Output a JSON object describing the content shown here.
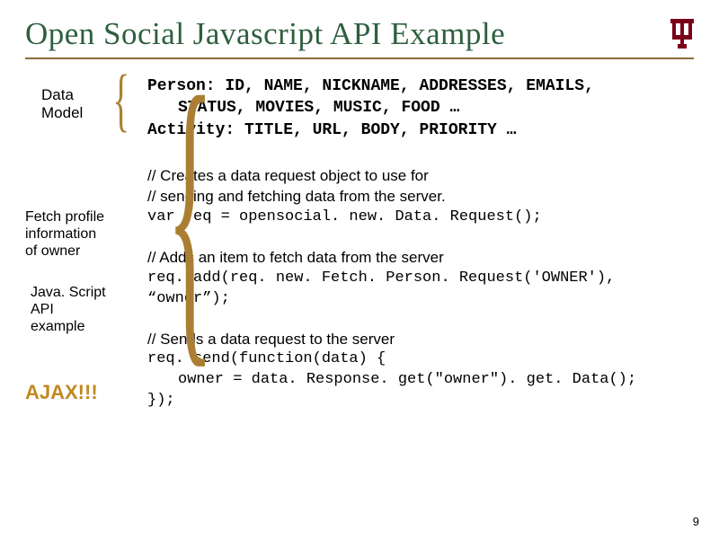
{
  "title": "Open Social Javascript API Example",
  "page_number": "9",
  "left": {
    "data_model_label": "Data\nModel",
    "fetch_label": "Fetch profile\ninformation\nof owner",
    "js_label": "Java. Script\nAPI\nexample",
    "ajax_label": "AJAX!!!"
  },
  "data_model": {
    "line1": "Person: ID, NAME, NICKNAME, ADDRESSES, EMAILS,",
    "line2": "STATUS, MOVIES, MUSIC, FOOD …",
    "line3": "Activity: TITLE, URL, BODY, PRIORITY …"
  },
  "block1": {
    "c1": "// Creates a data request object to use for",
    "c2": "// sending and fetching data from the server.",
    "code": "var req = opensocial. new. Data. Request();"
  },
  "block2": {
    "c1": "// Adds an item to fetch data from the server",
    "code": "req. add(req. new. Fetch. Person. Request('OWNER'), “owner”);"
  },
  "block3": {
    "c1": "// Sends a data request to the server",
    "l1": "req. send(function(data) {",
    "l2": "owner  = data. Response. get(\"owner\"). get. Data();",
    "l3": "});"
  }
}
